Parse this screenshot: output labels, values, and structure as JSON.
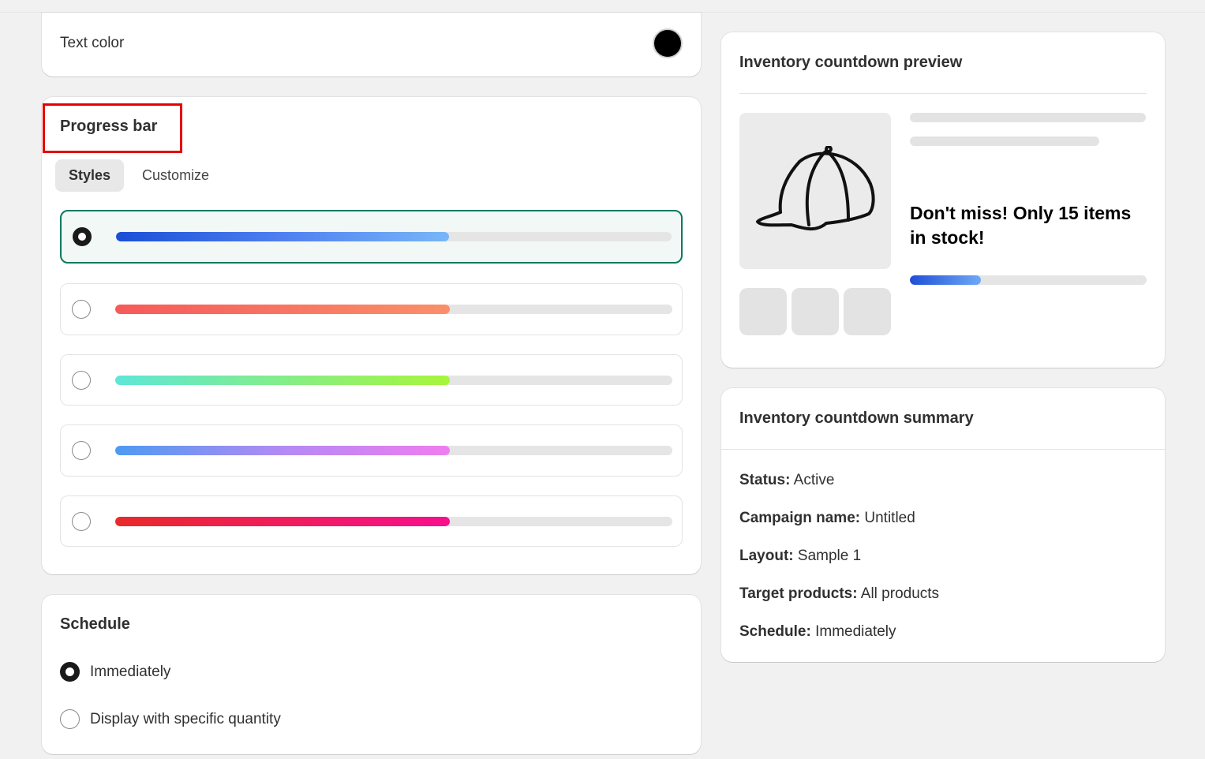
{
  "text_color": {
    "label": "Text color",
    "swatch": "#000000"
  },
  "progress": {
    "title": "Progress bar",
    "tabs": [
      {
        "label": "Styles",
        "active": true
      },
      {
        "label": "Customize",
        "active": false
      }
    ],
    "options": [
      {
        "selected": true,
        "fill_percent": 60,
        "gradient": [
          "#1a4fd6",
          "#4f7ff0",
          "#79b6f8"
        ]
      },
      {
        "selected": false,
        "fill_percent": 60,
        "gradient": [
          "#f55a5a",
          "#f9906a"
        ]
      },
      {
        "selected": false,
        "fill_percent": 60,
        "gradient": [
          "#5ee6d8",
          "#a8f53a"
        ]
      },
      {
        "selected": false,
        "fill_percent": 60,
        "gradient": [
          "#4d9af2",
          "#b38af4",
          "#f07df0"
        ]
      },
      {
        "selected": false,
        "fill_percent": 60,
        "gradient": [
          "#e82a2a",
          "#f70f8e"
        ]
      }
    ]
  },
  "schedule": {
    "title": "Schedule",
    "options": [
      {
        "label": "Immediately",
        "selected": true
      },
      {
        "label": "Display with specific quantity",
        "selected": false
      }
    ]
  },
  "preview": {
    "title": "Inventory countdown preview",
    "product_icon": "cap-icon",
    "message": "Don't miss! Only 15 items in stock!",
    "progress_percent": 30
  },
  "summary": {
    "title": "Inventory countdown summary",
    "rows": [
      {
        "key": "Status:",
        "value": "Active"
      },
      {
        "key": "Campaign name:",
        "value": "Untitled"
      },
      {
        "key": "Layout:",
        "value": "Sample 1"
      },
      {
        "key": "Target products:",
        "value": "All products"
      },
      {
        "key": "Schedule:",
        "value": "Immediately"
      }
    ]
  }
}
